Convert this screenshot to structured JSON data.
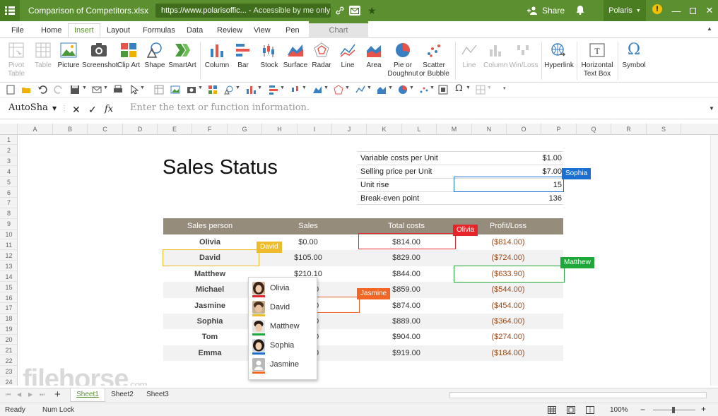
{
  "titlebar": {
    "file_name": "Comparison of Competitors.xlsx",
    "url": "https://www.polarisoffic...",
    "access": "Accessible by me only",
    "share_label": "Share",
    "user_label": "Polaris",
    "accent": "#5b8f2f"
  },
  "tabs": [
    "File",
    "Home",
    "Insert",
    "Layout",
    "Formulas",
    "Data",
    "Review",
    "View",
    "Pen",
    "Chart"
  ],
  "ribbon": {
    "pivot": "Pivot\nTable",
    "table": "Table",
    "picture": "Picture",
    "screenshot": "Screenshot",
    "clipart": "Clip Art",
    "shape": "Shape",
    "smartart": "SmartArt",
    "column": "Column",
    "bar": "Bar",
    "stock": "Stock",
    "surface": "Surface",
    "radar": "Radar",
    "line": "Line",
    "area": "Area",
    "pie": "Pie or\nDoughnut",
    "scatter": "Scatter\nor Bubble",
    "spark_line": "Line",
    "spark_column": "Column",
    "spark_winloss": "Win/Loss",
    "hyperlink": "Hyperlink",
    "textbox": "Horizontal\nText Box",
    "symbol": "Symbol"
  },
  "formula": {
    "name_box": "AutoSha",
    "placeholder": "Enter the text or function information.",
    "fx": "fx"
  },
  "columns": [
    "A",
    "B",
    "C",
    "D",
    "E",
    "F",
    "G",
    "H",
    "I",
    "J",
    "K",
    "L",
    "M",
    "N",
    "O",
    "P",
    "Q",
    "R",
    "S"
  ],
  "rows": [
    "1",
    "2",
    "3",
    "4",
    "5",
    "6",
    "7",
    "8",
    "9",
    "10",
    "11",
    "12",
    "13",
    "14",
    "15",
    "16",
    "17",
    "18",
    "19",
    "20",
    "21",
    "22",
    "23",
    "24"
  ],
  "sheet": {
    "title": "Sales Status",
    "info": [
      {
        "label": "Variable costs per Unit",
        "value": "$1.00"
      },
      {
        "label": "Selling price per Unit",
        "value": "$7.00"
      },
      {
        "label": "Unit rise",
        "value": "15"
      },
      {
        "label": "Break-even point",
        "value": "136"
      }
    ],
    "headers": [
      "Sales person",
      "Sales",
      "Total costs",
      "Profit/Loss"
    ],
    "data": [
      {
        "name": "Olivia",
        "sales": "$0.00",
        "costs": "$814.00",
        "pl": "($814.00)"
      },
      {
        "name": "David",
        "sales": "$105.00",
        "costs": "$829.00",
        "pl": "($724.00)"
      },
      {
        "name": "Matthew",
        "sales": "$210.10",
        "costs": "$844.00",
        "pl": "($633.90)"
      },
      {
        "name": "Michael",
        "sales": "0",
        "costs": "$859.00",
        "pl": "($544.00)"
      },
      {
        "name": "Jasmine",
        "sales": "0",
        "costs": "$874.00",
        "pl": "($454.00)"
      },
      {
        "name": "Sophia",
        "sales": "0",
        "costs": "$889.00",
        "pl": "($364.00)"
      },
      {
        "name": "Tom",
        "sales": "0",
        "costs": "$904.00",
        "pl": "($274.00)"
      },
      {
        "name": "Emma",
        "sales": "0",
        "costs": "$919.00",
        "pl": "($184.00)"
      }
    ]
  },
  "collaborators": {
    "sophia": {
      "name": "Sophia",
      "color": "#1a6fd1"
    },
    "olivia": {
      "name": "Olivia",
      "color": "#e8232a"
    },
    "david": {
      "name": "David",
      "color": "#f0bb2a"
    },
    "matthew": {
      "name": "Matthew",
      "color": "#1fa83a"
    },
    "jasmine": {
      "name": "Jasmine",
      "color": "#f26522"
    }
  },
  "popup": [
    {
      "name": "Olivia",
      "color": "#e8232a"
    },
    {
      "name": "David",
      "color": "#f0bb2a"
    },
    {
      "name": "Matthew",
      "color": "#1fa83a"
    },
    {
      "name": "Sophia",
      "color": "#1a6fd1"
    },
    {
      "name": "Jasmine",
      "color": "#f26522"
    }
  ],
  "watermark": {
    "text": "filehorse",
    "suffix": ".com"
  },
  "sheets": [
    "Sheet1",
    "Sheet2",
    "Sheet3"
  ],
  "status": {
    "ready": "Ready",
    "numlock": "Num Lock",
    "zoom": "100%"
  }
}
